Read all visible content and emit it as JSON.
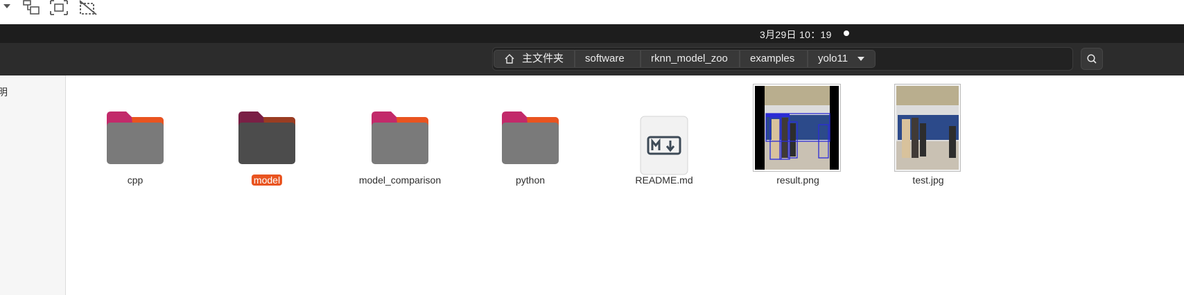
{
  "top_bar": {
    "clock": "3月29日  10：19"
  },
  "toolbar_icons": [
    "dropdown-arrow-icon",
    "move-down-icon",
    "screenshot-area-icon",
    "no-crop-icon"
  ],
  "pathbar": {
    "crumbs": [
      "主文件夹",
      "software",
      "rknn_model_zoo",
      "examples",
      "yolo11"
    ],
    "home_icon": "home-icon",
    "menu_icon": "chevron-down-icon"
  },
  "search_icon": "search-icon",
  "sidebar": {
    "fragment": "明"
  },
  "files": [
    {
      "name": "cpp",
      "type": "folder",
      "selected": false
    },
    {
      "name": "model",
      "type": "folder",
      "selected": true
    },
    {
      "name": "model_comparison",
      "type": "folder",
      "selected": false
    },
    {
      "name": "python",
      "type": "folder",
      "selected": false
    },
    {
      "name": "README.md",
      "type": "markdown",
      "selected": false
    },
    {
      "name": "result.png",
      "type": "image",
      "selected": false
    },
    {
      "name": "test.jpg",
      "type": "image",
      "selected": false
    }
  ],
  "colors": {
    "accent": "#e95420",
    "folder_tab": "#c3286b",
    "folder_body": "#7a7a7a"
  }
}
